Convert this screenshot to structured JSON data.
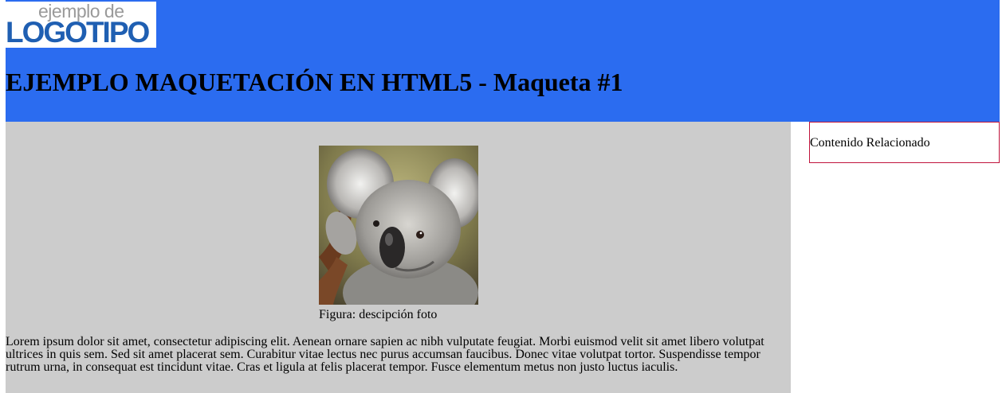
{
  "header": {
    "logo": {
      "top_text": "ejemplo de",
      "main_text": "LOGOTIPO"
    },
    "title": "EJEMPLO MAQUETACIÓN EN HTML5 - Maqueta #1",
    "background_color": "#2b6cf0"
  },
  "main": {
    "background_color": "#cccccc",
    "figure": {
      "image_icon": "koala-photo",
      "caption": "Figura: descipción foto"
    },
    "paragraph": "Lorem ipsum dolor sit amet, consectetur adipiscing elit. Aenean ornare sapien ac nibh vulputate feugiat. Morbi euismod velit sit amet libero volutpat ultrices in quis sem. Sed sit amet placerat sem. Curabitur vitae lectus nec purus accumsan faucibus. Donec vitae volutpat tortor. Suspendisse tempor rutrum urna, in consequat est tincidunt vitae. Cras et ligula at felis placerat tempor. Fusce elementum metus non justo luctus iaculis."
  },
  "aside": {
    "label": "Contenido Relacionado",
    "border_color": "#c0143c"
  }
}
